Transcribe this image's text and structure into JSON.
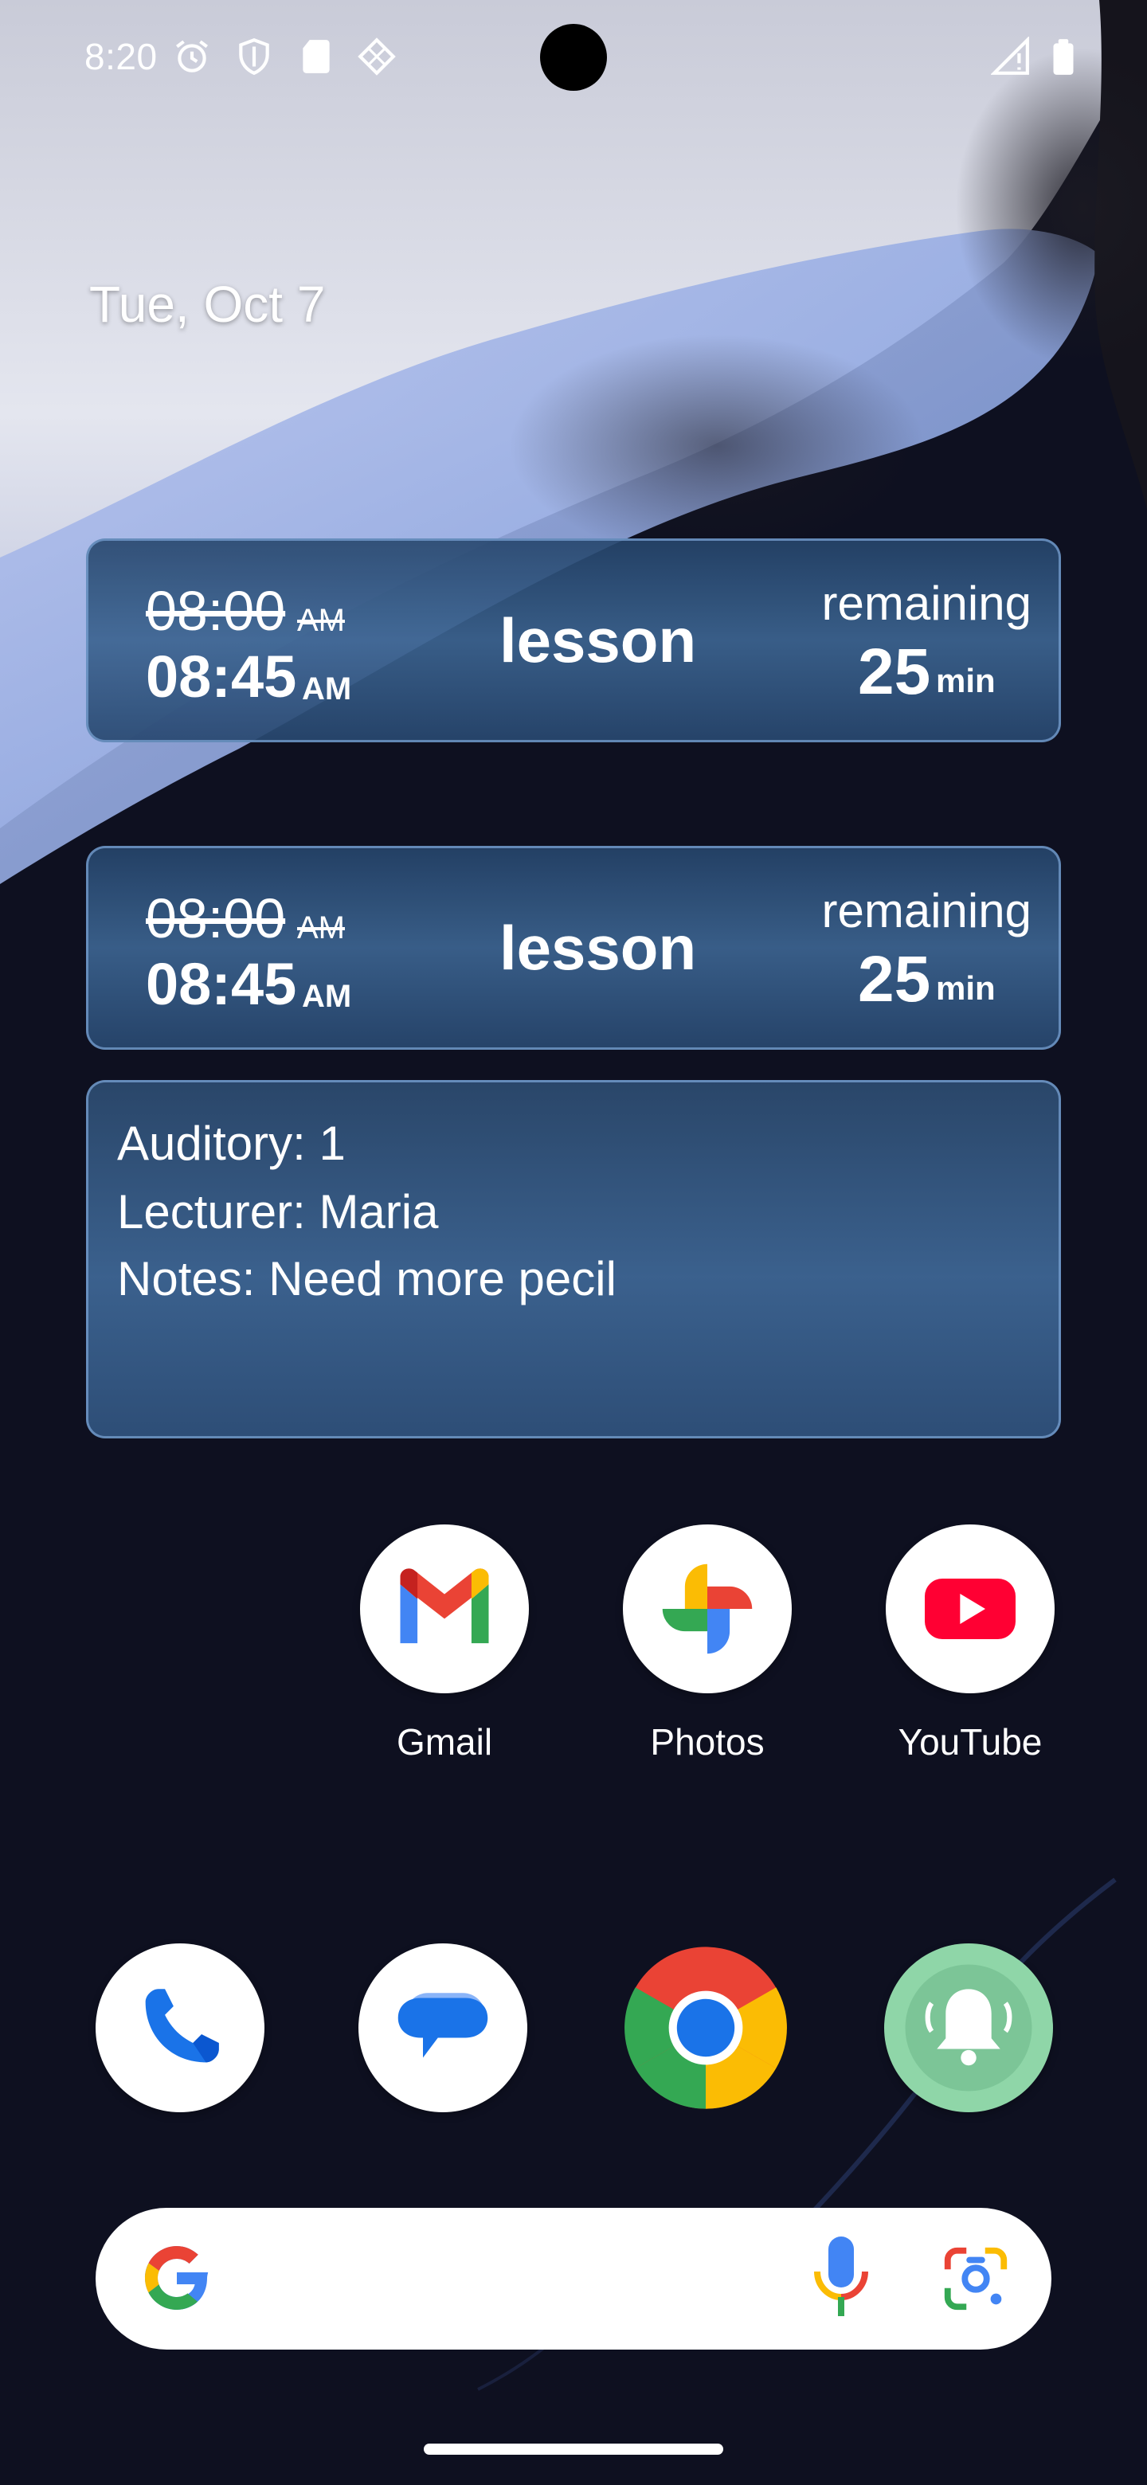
{
  "status_bar": {
    "time": "8:20",
    "icons": [
      "alarm-icon",
      "shield-icon",
      "sd-card-icon",
      "diamond-grid-icon",
      "signal-icon",
      "battery-icon"
    ]
  },
  "date": "Tue, Oct 7",
  "schedule_widgets": [
    {
      "start_time": "08:00",
      "start_suffix": "AM",
      "end_time": "08:45",
      "end_suffix": "AM",
      "title": "lesson",
      "remaining_label": "remaining",
      "remaining_value": "25",
      "remaining_unit": "min"
    },
    {
      "start_time": "08:00",
      "start_suffix": "AM",
      "end_time": "08:45",
      "end_suffix": "AM",
      "title": "lesson",
      "remaining_label": "remaining",
      "remaining_value": "25",
      "remaining_unit": "min"
    }
  ],
  "details_widget": {
    "auditory": "Auditory: 1",
    "lecturer": "Lecturer: Maria",
    "notes": "Notes: Need more pecil"
  },
  "apps": [
    {
      "label": "Gmail",
      "icon": "gmail-icon"
    },
    {
      "label": "Photos",
      "icon": "photos-icon"
    },
    {
      "label": "YouTube",
      "icon": "youtube-icon"
    }
  ],
  "dock": [
    {
      "icon": "phone-icon"
    },
    {
      "icon": "messages-icon"
    },
    {
      "icon": "chrome-icon"
    },
    {
      "icon": "bell-app-icon"
    }
  ],
  "search": {
    "icons": [
      "google-g-icon",
      "microphone-icon",
      "lens-icon"
    ]
  },
  "colors": {
    "widget_border": "#78a0d2",
    "widget_bg": "#3c6491",
    "youtube_red": "#ff0033",
    "bell_green": "#8fd6a8"
  }
}
